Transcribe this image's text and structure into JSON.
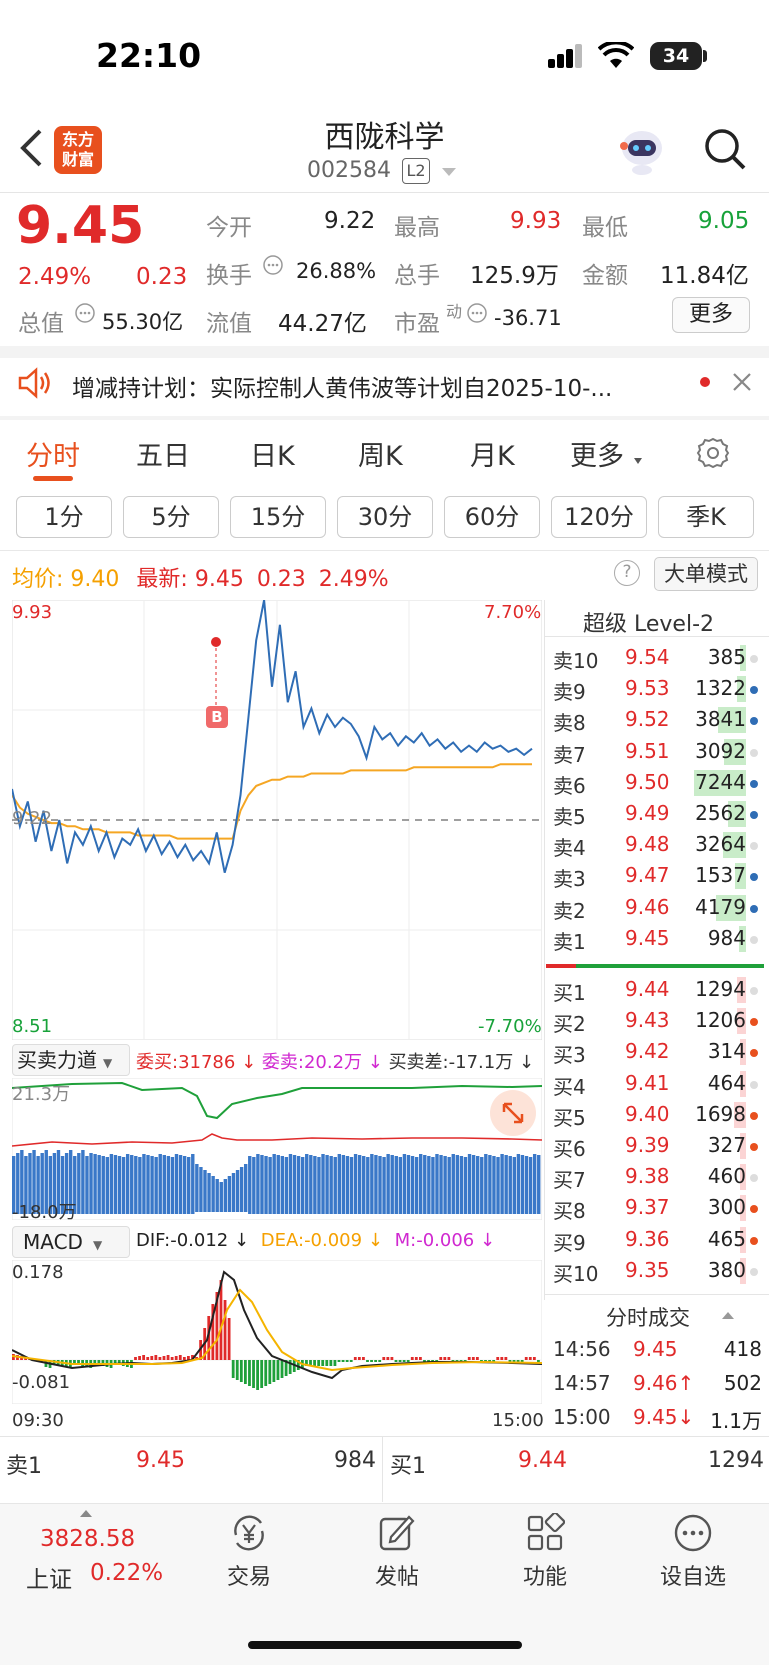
{
  "status": {
    "time": "22:10",
    "battery": "34"
  },
  "header": {
    "title": "西陇科学",
    "code": "002584",
    "level": "L2",
    "logo_line1": "东方",
    "logo_line2": "财富"
  },
  "quote": {
    "price": "9.45",
    "pct": "2.49%",
    "chg": "0.23",
    "open_label": "今开",
    "open": "9.22",
    "high_label": "最高",
    "high": "9.93",
    "low_label": "最低",
    "low": "9.05",
    "turnover_label": "换手",
    "turnover": "26.88%",
    "vol_label": "总手",
    "vol": "125.9万",
    "amount_label": "金额",
    "amount": "11.84亿",
    "mcap_label": "总值",
    "mcap": "55.30亿",
    "float_label": "流值",
    "float": "44.27亿",
    "pe_label": "市盈",
    "pe_sup": "动",
    "pe": "-36.71",
    "more": "更多"
  },
  "notice": {
    "text": "增减持计划：实际控制人黄伟波等计划自2025-10-..."
  },
  "tabs": [
    "分时",
    "五日",
    "日K",
    "周K",
    "月K",
    "更多"
  ],
  "periods": [
    "1分",
    "5分",
    "15分",
    "30分",
    "60分",
    "120分",
    "季K"
  ],
  "info": {
    "avg_label": "均价:",
    "avg": "9.40",
    "latest_label": "最新:",
    "latest": "9.45",
    "chg": "0.23",
    "pct": "2.49%",
    "big_order": "大单模式"
  },
  "chart": {
    "y_high": "9.93",
    "y_low": "8.51",
    "pct_high": "7.70%",
    "pct_low": "-7.70%",
    "base": "9.22",
    "b_marker": "B",
    "t_start": "09:30",
    "t_end": "15:00"
  },
  "chart_data": {
    "type": "line",
    "x_range": [
      "09:30",
      "15:00"
    ],
    "ylim": [
      8.51,
      9.93
    ],
    "prev_close": 9.22,
    "series": [
      {
        "name": "price",
        "values": [
          9.32,
          9.2,
          9.28,
          9.15,
          9.25,
          9.12,
          9.22,
          9.08,
          9.18,
          9.14,
          9.2,
          9.12,
          9.18,
          9.1,
          9.16,
          9.14,
          9.19,
          9.12,
          9.17,
          9.11,
          9.15,
          9.1,
          9.14,
          9.09,
          9.12,
          9.08,
          9.18,
          9.05,
          9.14,
          9.3,
          9.55,
          9.8,
          9.93,
          9.65,
          9.85,
          9.6,
          9.7,
          9.52,
          9.58,
          9.5,
          9.56,
          9.52,
          9.55,
          9.53,
          9.49,
          9.42,
          9.52,
          9.48,
          9.5,
          9.46,
          9.49,
          9.47,
          9.5,
          9.46,
          9.48,
          9.45,
          9.47,
          9.44,
          9.46,
          9.44,
          9.47,
          9.45,
          9.46,
          9.44,
          9.45,
          9.43,
          9.45
        ]
      },
      {
        "name": "avg",
        "values": [
          9.3,
          9.26,
          9.24,
          9.23,
          9.22,
          9.21,
          9.21,
          9.2,
          9.2,
          9.19,
          9.19,
          9.19,
          9.18,
          9.18,
          9.18,
          9.18,
          9.17,
          9.17,
          9.17,
          9.17,
          9.17,
          9.16,
          9.16,
          9.16,
          9.16,
          9.16,
          9.16,
          9.16,
          9.16,
          9.25,
          9.3,
          9.33,
          9.34,
          9.35,
          9.35,
          9.36,
          9.36,
          9.36,
          9.37,
          9.37,
          9.37,
          9.37,
          9.37,
          9.38,
          9.38,
          9.38,
          9.38,
          9.38,
          9.38,
          9.38,
          9.38,
          9.39,
          9.39,
          9.39,
          9.39,
          9.39,
          9.39,
          9.39,
          9.39,
          9.39,
          9.39,
          9.39,
          9.4,
          9.4,
          9.4,
          9.4,
          9.4
        ]
      }
    ]
  },
  "force": {
    "title": "买卖力道",
    "buy_label": "委买:",
    "buy": "31786",
    "sell_label": "委卖:",
    "sell": "20.2万",
    "diff_label": "买卖差:",
    "diff": "-17.1万",
    "top": "21.3万",
    "bottom": "-18.0万"
  },
  "macd": {
    "title": "MACD",
    "dif_label": "DIF:",
    "dif": "-0.012",
    "dea_label": "DEA:",
    "dea": "-0.009",
    "m_label": "M:",
    "m": "-0.006",
    "top": "0.178",
    "bottom": "-0.081"
  },
  "orderbook": {
    "title": "超级 Level-2",
    "asks": [
      {
        "label": "卖10",
        "price": "9.54",
        "vol": "385",
        "bar": 0.05
      },
      {
        "label": "卖9",
        "price": "9.53",
        "vol": "1322",
        "bar": 0.18
      },
      {
        "label": "卖8",
        "price": "9.52",
        "vol": "3841",
        "bar": 0.53
      },
      {
        "label": "卖7",
        "price": "9.51",
        "vol": "3092",
        "bar": 0.43
      },
      {
        "label": "卖6",
        "price": "9.50",
        "vol": "7244",
        "bar": 1.0
      },
      {
        "label": "卖5",
        "price": "9.49",
        "vol": "2562",
        "bar": 0.35
      },
      {
        "label": "卖4",
        "price": "9.48",
        "vol": "3264",
        "bar": 0.45
      },
      {
        "label": "卖3",
        "price": "9.47",
        "vol": "1537",
        "bar": 0.21
      },
      {
        "label": "卖2",
        "price": "9.46",
        "vol": "4179",
        "bar": 0.58
      },
      {
        "label": "卖1",
        "price": "9.45",
        "vol": "984",
        "bar": 0.14
      }
    ],
    "bids": [
      {
        "label": "买1",
        "price": "9.44",
        "vol": "1294",
        "bar": 0.18
      },
      {
        "label": "买2",
        "price": "9.43",
        "vol": "1206",
        "bar": 0.17
      },
      {
        "label": "买3",
        "price": "9.42",
        "vol": "314",
        "bar": 0.04
      },
      {
        "label": "买4",
        "price": "9.41",
        "vol": "464",
        "bar": 0.06
      },
      {
        "label": "买5",
        "price": "9.40",
        "vol": "1698",
        "bar": 0.23
      },
      {
        "label": "买6",
        "price": "9.39",
        "vol": "327",
        "bar": 0.05
      },
      {
        "label": "买7",
        "price": "9.38",
        "vol": "460",
        "bar": 0.06
      },
      {
        "label": "买8",
        "price": "9.37",
        "vol": "300",
        "bar": 0.04
      },
      {
        "label": "买9",
        "price": "9.36",
        "vol": "465",
        "bar": 0.06
      },
      {
        "label": "买10",
        "price": "9.35",
        "vol": "380",
        "bar": 0.05
      }
    ],
    "ticks_title": "分时成交",
    "ticks": [
      {
        "time": "14:56",
        "price": "9.45",
        "vol": "418"
      },
      {
        "time": "14:57",
        "price": "9.46↑",
        "vol": "502"
      },
      {
        "time": "15:00",
        "price": "9.45↓",
        "vol": "1.1万"
      }
    ]
  },
  "bottom_quote": {
    "sell_label": "卖1",
    "sell_price": "9.45",
    "sell_vol": "984",
    "buy_label": "买1",
    "buy_price": "9.44",
    "buy_vol": "1294"
  },
  "bottom_bar": {
    "index_value": "3828.58",
    "index_name": "上证",
    "index_pct": "0.22%",
    "trade": "交易",
    "post": "发帖",
    "func": "功能",
    "watch": "设自选"
  }
}
